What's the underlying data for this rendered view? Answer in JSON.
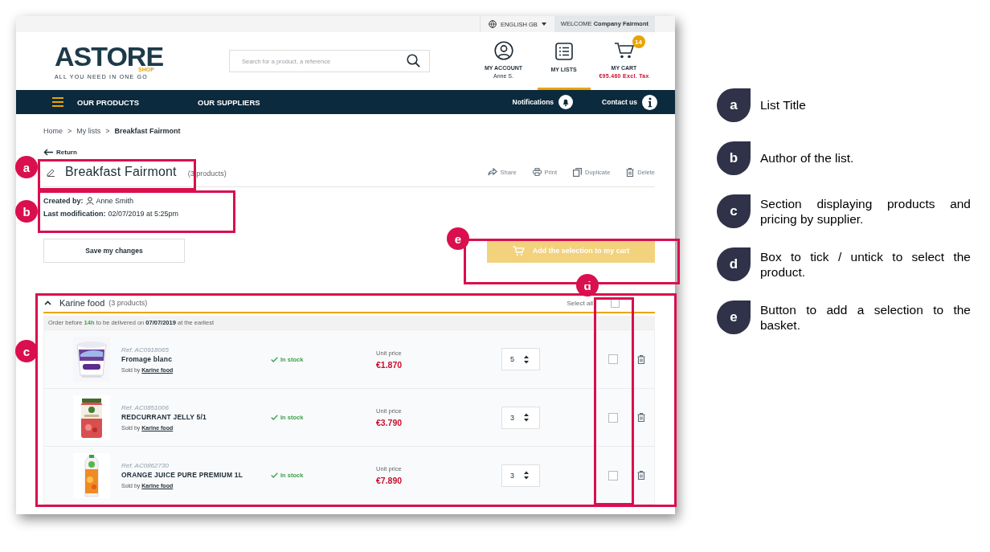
{
  "header": {
    "language": "ENGLISH GB",
    "welcome": "WELCOME **Company Fairmont**",
    "logo": {
      "name": "ASTORE",
      "sub": "SHOP",
      "tagline": "ALL YOU NEED IN ONE GO"
    },
    "search": {
      "placeholder": "Search for a product, a reference"
    },
    "account": {
      "label": "MY ACCOUNT",
      "user": "Anne S."
    },
    "lists": {
      "label": "MY LISTS",
      "selected": true
    },
    "cart": {
      "label": "MY CART",
      "count": "14",
      "total": "€95.460 Excl. Tax"
    }
  },
  "nav": {
    "items": [
      "OUR PRODUCTS",
      "OUR SUPPLIERS"
    ],
    "notifications": "Notifications",
    "contact": "Contact us"
  },
  "breadcrumb": {
    "separator": ">",
    "items": [
      "Home",
      "My lists",
      "Breakfast Fairmont"
    ]
  },
  "return": "Return",
  "list": {
    "title": "Breakfast Fairmont",
    "count": "(3 products)",
    "actions": [
      {
        "kind": "share",
        "label": "Share"
      },
      {
        "kind": "print",
        "label": "Print"
      },
      {
        "kind": "duplicate",
        "label": "Duplicate"
      },
      {
        "kind": "delete",
        "label": "Delete"
      }
    ],
    "created_label": "Created by:",
    "author": "Anne Smith",
    "modified_label": "Last modification:",
    "modified": "02/07/2019 at 5:25pm"
  },
  "save_button": "Save my changes",
  "add_button": {
    "label": "Add the selection to my cart",
    "disabled": true
  },
  "supplier": {
    "name": "Karine food",
    "count": "(3 products)",
    "expanded": true,
    "select_all": {
      "label": "Select all",
      "checked": false
    },
    "notice": "Order before **14h** to be delivered on **07/07/2019** at the earliest",
    "products": [
      {
        "kind": "tub",
        "ref": "Ref. AC0918065",
        "name": "Fromage blanc",
        "sold_label": "Sold by",
        "seller": "Karine food",
        "stock": "In stock",
        "price_label": "Unit price",
        "price": "€1.870",
        "quantity": "5",
        "selected": false
      },
      {
        "kind": "jar",
        "ref": "Ref. AC0851006",
        "name": "REDCURRANT JELLY 5/1",
        "sold_label": "Sold by",
        "seller": "Karine food",
        "stock": "In stock",
        "price_label": "Unit price",
        "price": "€3.790",
        "quantity": "3",
        "selected": false
      },
      {
        "kind": "carton",
        "ref": "Ref. AC0862730",
        "name": "ORANGE JUICE PURE PREMIUM 1L",
        "sold_label": "Sold by",
        "seller": "Karine food",
        "stock": "In stock",
        "price_label": "Unit price",
        "price": "€7.890",
        "quantity": "3",
        "selected": false
      }
    ]
  },
  "callouts": [
    "a",
    "b",
    "c",
    "d",
    "e"
  ],
  "legend": [
    {
      "letter": "a",
      "text": "List Title"
    },
    {
      "letter": "b",
      "text": "Author of the list."
    },
    {
      "letter": "c",
      "text": "Section displaying products and pricing by supplier."
    },
    {
      "letter": "d",
      "text": "Box to tick / untick to select the product."
    },
    {
      "letter": "e",
      "text": "Button to add a selection to the basket."
    }
  ]
}
